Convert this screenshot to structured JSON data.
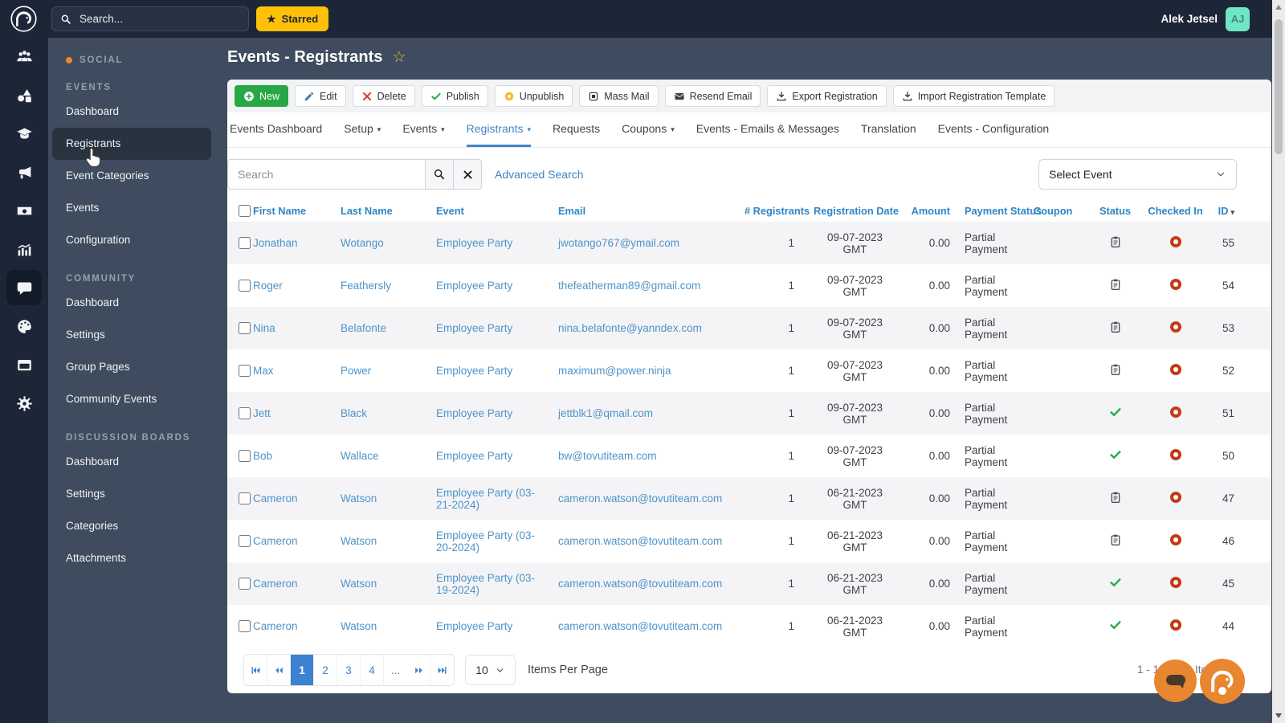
{
  "topbar": {
    "search_placeholder": "Search...",
    "starred_label": "Starred",
    "user_name": "Alek Jetsel",
    "avatar_initials": "AJ"
  },
  "icons": {
    "star_filled": "★",
    "star_outline": "☆",
    "caret_down": "▾"
  },
  "rail": {
    "items": [
      "users",
      "shapes",
      "graduation-cap",
      "megaphone",
      "money",
      "analytics",
      "comment",
      "palette",
      "window",
      "gear"
    ],
    "active_item": "comment"
  },
  "sidebar": {
    "sections": [
      {
        "header": "SOCIAL",
        "has_dot": true,
        "items": []
      },
      {
        "header": "EVENTS",
        "items": [
          {
            "label": "Dashboard"
          },
          {
            "label": "Registrants",
            "active": true
          },
          {
            "label": "Event Categories"
          },
          {
            "label": "Events"
          },
          {
            "label": "Configuration"
          }
        ]
      },
      {
        "header": "COMMUNITY",
        "items": [
          {
            "label": "Dashboard"
          },
          {
            "label": "Settings"
          },
          {
            "label": "Group Pages"
          },
          {
            "label": "Community Events"
          }
        ]
      },
      {
        "header": "DISCUSSION BOARDS",
        "items": [
          {
            "label": "Dashboard"
          },
          {
            "label": "Settings"
          },
          {
            "label": "Categories"
          },
          {
            "label": "Attachments"
          }
        ]
      }
    ]
  },
  "page": {
    "title": "Events - Registrants"
  },
  "toolbar": {
    "buttons": [
      {
        "label": "New",
        "icon": "plus-circle",
        "style": "primary"
      },
      {
        "label": "Edit",
        "icon": "pencil"
      },
      {
        "label": "Delete",
        "icon": "x-red"
      },
      {
        "label": "Publish",
        "icon": "check-green"
      },
      {
        "label": "Unpublish",
        "icon": "yellow-dot"
      },
      {
        "label": "Mass Mail",
        "icon": "square"
      },
      {
        "label": "Resend Email",
        "icon": "envelope"
      },
      {
        "label": "Export Registration",
        "icon": "download"
      },
      {
        "label": "Import Registration Template",
        "icon": "download"
      }
    ]
  },
  "tabs": [
    {
      "label": "Events Dashboard"
    },
    {
      "label": "Setup",
      "caret": true
    },
    {
      "label": "Events",
      "caret": true
    },
    {
      "label": "Registrants",
      "caret": true,
      "active": true
    },
    {
      "label": "Requests"
    },
    {
      "label": "Coupons",
      "caret": true
    },
    {
      "label": "Events - Emails & Messages"
    },
    {
      "label": "Translation"
    },
    {
      "label": "Events - Configuration"
    }
  ],
  "filters": {
    "search_placeholder": "Search",
    "advanced_search_label": "Advanced Search",
    "select_event_label": "Select Event"
  },
  "table": {
    "columns": [
      "First Name",
      "Last Name",
      "Event",
      "Email",
      "# Registrants",
      "Registration Date",
      "Amount",
      "Payment Status",
      "Coupon",
      "Status",
      "Checked In",
      "ID"
    ],
    "rows": [
      {
        "first_name": "Jonathan",
        "last_name": "Wotango",
        "event": "Employee Party",
        "email": "jwotango767@ymail.com",
        "registrants": "1",
        "reg_date": "09-07-2023",
        "reg_tz": "GMT",
        "amount": "0.00",
        "payment_status": "Partial Payment",
        "coupon": "",
        "status": "pending",
        "checked_in": "no",
        "id": "55"
      },
      {
        "first_name": "Roger",
        "last_name": "Feathersly",
        "event": "Employee Party",
        "email": "thefeatherman89@gmail.com",
        "registrants": "1",
        "reg_date": "09-07-2023",
        "reg_tz": "GMT",
        "amount": "0.00",
        "payment_status": "Partial Payment",
        "coupon": "",
        "status": "pending",
        "checked_in": "no",
        "id": "54"
      },
      {
        "first_name": "Nina",
        "last_name": "Belafonte",
        "event": "Employee Party",
        "email": "nina.belafonte@yanndex.com",
        "registrants": "1",
        "reg_date": "09-07-2023",
        "reg_tz": "GMT",
        "amount": "0.00",
        "payment_status": "Partial Payment",
        "coupon": "",
        "status": "pending",
        "checked_in": "no",
        "id": "53"
      },
      {
        "first_name": "Max",
        "last_name": "Power",
        "event": "Employee Party",
        "email": "maximum@power.ninja",
        "registrants": "1",
        "reg_date": "09-07-2023",
        "reg_tz": "GMT",
        "amount": "0.00",
        "payment_status": "Partial Payment",
        "coupon": "",
        "status": "pending",
        "checked_in": "no",
        "id": "52"
      },
      {
        "first_name": "Jett",
        "last_name": "Black",
        "event": "Employee Party",
        "email": "jettblk1@qmail.com",
        "registrants": "1",
        "reg_date": "09-07-2023",
        "reg_tz": "GMT",
        "amount": "0.00",
        "payment_status": "Partial Payment",
        "coupon": "",
        "status": "attended",
        "checked_in": "no",
        "id": "51"
      },
      {
        "first_name": "Bob",
        "last_name": "Wallace",
        "event": "Employee Party",
        "email": "bw@tovutiteam.com",
        "registrants": "1",
        "reg_date": "09-07-2023",
        "reg_tz": "GMT",
        "amount": "0.00",
        "payment_status": "Partial Payment",
        "coupon": "",
        "status": "attended",
        "checked_in": "no",
        "id": "50"
      },
      {
        "first_name": "Cameron",
        "last_name": "Watson",
        "event": "Employee Party (03-21-2024)",
        "email": "cameron.watson@tovutiteam.com",
        "registrants": "1",
        "reg_date": "06-21-2023",
        "reg_tz": "GMT",
        "amount": "0.00",
        "payment_status": "Partial Payment",
        "coupon": "",
        "status": "pending",
        "checked_in": "no",
        "id": "47"
      },
      {
        "first_name": "Cameron",
        "last_name": "Watson",
        "event": "Employee Party (03-20-2024)",
        "email": "cameron.watson@tovutiteam.com",
        "registrants": "1",
        "reg_date": "06-21-2023",
        "reg_tz": "GMT",
        "amount": "0.00",
        "payment_status": "Partial Payment",
        "coupon": "",
        "status": "pending",
        "checked_in": "no",
        "id": "46"
      },
      {
        "first_name": "Cameron",
        "last_name": "Watson",
        "event": "Employee Party (03-19-2024)",
        "email": "cameron.watson@tovutiteam.com",
        "registrants": "1",
        "reg_date": "06-21-2023",
        "reg_tz": "GMT",
        "amount": "0.00",
        "payment_status": "Partial Payment",
        "coupon": "",
        "status": "attended",
        "checked_in": "no",
        "id": "45"
      },
      {
        "first_name": "Cameron",
        "last_name": "Watson",
        "event": "Employee Party",
        "email": "cameron.watson@tovutiteam.com",
        "registrants": "1",
        "reg_date": "06-21-2023",
        "reg_tz": "GMT",
        "amount": "0.00",
        "payment_status": "Partial Payment",
        "coupon": "",
        "status": "attended",
        "checked_in": "no",
        "id": "44"
      }
    ]
  },
  "pagination": {
    "pages": [
      {
        "label": "1",
        "active": true
      },
      {
        "label": "2"
      },
      {
        "label": "3"
      },
      {
        "label": "4"
      },
      {
        "label": "..."
      }
    ],
    "per_page": "10",
    "items_per_page_label": "Items Per Page",
    "range_text": "1 - 10 of 44 Items"
  },
  "colors": {
    "topbar_dark": "#1d2637",
    "sidebar_slate": "#3f4b5e",
    "accent_blue": "#4285c8",
    "table_header_blue": "#2e86c6",
    "starred_yellow": "#ffc107",
    "new_green": "#28a745",
    "fab_orange": "#e8872f",
    "checked_in_red": "#c23b16",
    "avatar_mint": "#70e6c6"
  }
}
